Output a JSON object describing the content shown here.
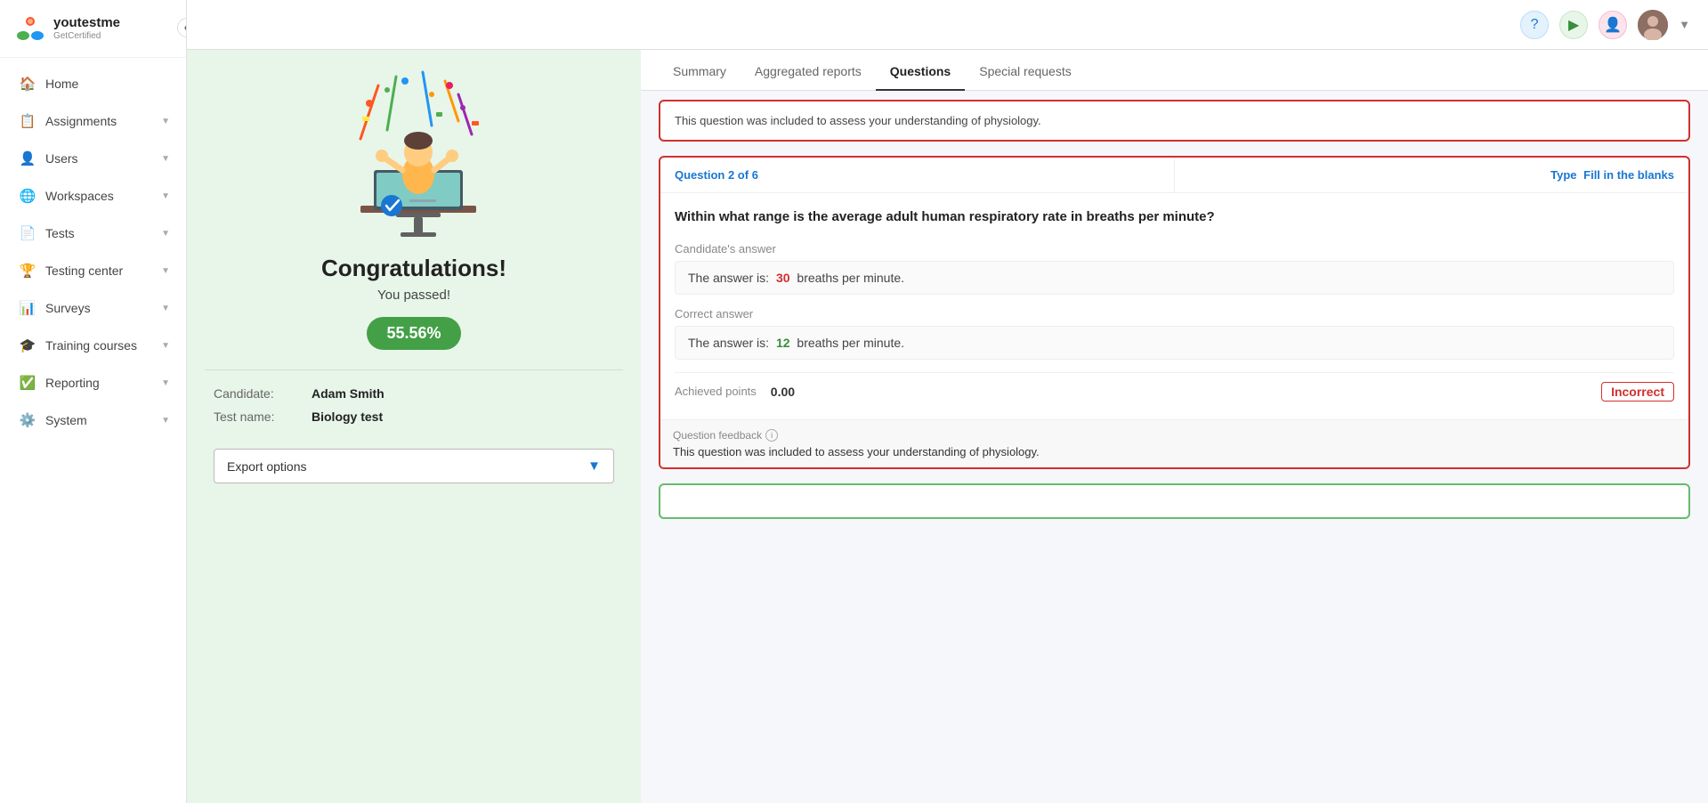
{
  "sidebar": {
    "logo_main": "youtestme",
    "logo_sub": "GetCertified",
    "collapse_icon": "❮",
    "items": [
      {
        "id": "home",
        "label": "Home",
        "icon": "🏠",
        "has_arrow": false
      },
      {
        "id": "assignments",
        "label": "Assignments",
        "icon": "📋",
        "has_arrow": true
      },
      {
        "id": "users",
        "label": "Users",
        "icon": "👤",
        "has_arrow": true
      },
      {
        "id": "workspaces",
        "label": "Workspaces",
        "icon": "🌐",
        "has_arrow": true
      },
      {
        "id": "tests",
        "label": "Tests",
        "icon": "📄",
        "has_arrow": true
      },
      {
        "id": "testing-center",
        "label": "Testing center",
        "icon": "🏆",
        "has_arrow": true
      },
      {
        "id": "surveys",
        "label": "Surveys",
        "icon": "📊",
        "has_arrow": true
      },
      {
        "id": "training-courses",
        "label": "Training courses",
        "icon": "🎓",
        "has_arrow": true
      },
      {
        "id": "reporting",
        "label": "Reporting",
        "icon": "✅",
        "has_arrow": true
      },
      {
        "id": "system",
        "label": "System",
        "icon": "⚙️",
        "has_arrow": true
      }
    ]
  },
  "topbar": {
    "help_icon": "?",
    "play_icon": "▶",
    "person_icon": "👤"
  },
  "left_panel": {
    "congrats_title": "Congratulations!",
    "congrats_sub": "You passed!",
    "score": "55.56%",
    "candidate_label": "Candidate:",
    "candidate_value": "Adam Smith",
    "test_label": "Test name:",
    "test_value": "Biology test",
    "export_label": "Export options",
    "export_icon": "▼"
  },
  "tabs": [
    {
      "id": "summary",
      "label": "Summary"
    },
    {
      "id": "aggregated",
      "label": "Aggregated reports"
    },
    {
      "id": "questions",
      "label": "Questions",
      "active": true
    },
    {
      "id": "special",
      "label": "Special requests"
    }
  ],
  "question1": {
    "num_label": "Question",
    "num_value": "2 of 6",
    "type_label": "Type",
    "type_value": "Fill in the blanks",
    "question_text": "Within what range is the average adult human respiratory rate in breaths per minute?",
    "candidates_answer_label": "Candidate's answer",
    "candidates_answer_prefix": "The answer is:",
    "candidates_answer_value": "30",
    "candidates_answer_suffix": "breaths per minute.",
    "correct_answer_label": "Correct answer",
    "correct_answer_prefix": "The answer is:",
    "correct_answer_value": "12",
    "correct_answer_suffix": "breaths per minute.",
    "points_label": "Achieved points",
    "points_value": "0.00",
    "status": "Incorrect",
    "feedback_label": "Question feedback",
    "feedback_text": "This question was included to assess your understanding of physiology."
  },
  "prev_question_feedback": {
    "text": "This question was included to assess your understanding of physiology."
  }
}
